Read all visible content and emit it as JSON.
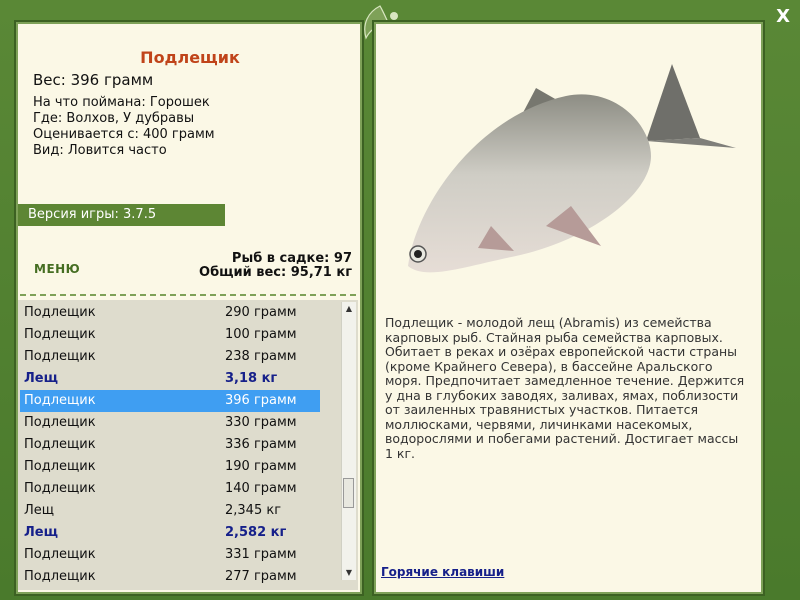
{
  "fish": {
    "name": "Подлещик",
    "weight": "Вес: 396 грамм",
    "bait": "На что поймана: Горошек",
    "place": "Где: Волхов, У дубравы",
    "rated": "Оценивается с: 400 грамм",
    "kind": "Вид: Ловится часто"
  },
  "version": "Версия игры: 3.7.5",
  "menu_label": "МЕНЮ",
  "cage": {
    "count": "Рыб в садке: 97",
    "total": "Общий вес: 95,71 кг"
  },
  "catch_list": [
    {
      "name": "Подлещик",
      "weight": "290 грамм",
      "style": "normal"
    },
    {
      "name": "Подлещик",
      "weight": "100 грамм",
      "style": "normal"
    },
    {
      "name": "Подлещик",
      "weight": "238 грамм",
      "style": "normal"
    },
    {
      "name": "Лещ",
      "weight": "3,18 кг",
      "style": "bold"
    },
    {
      "name": "Подлещик",
      "weight": "396 грамм",
      "style": "selected"
    },
    {
      "name": "Подлещик",
      "weight": "330 грамм",
      "style": "normal"
    },
    {
      "name": "Подлещик",
      "weight": "336 грамм",
      "style": "normal"
    },
    {
      "name": "Подлещик",
      "weight": "190 грамм",
      "style": "normal"
    },
    {
      "name": "Подлещик",
      "weight": "140 грамм",
      "style": "normal"
    },
    {
      "name": "Лещ",
      "weight": "2,345 кг",
      "style": "normal"
    },
    {
      "name": "Лещ",
      "weight": "2,582 кг",
      "style": "bold"
    },
    {
      "name": "Подлещик",
      "weight": "331 грамм",
      "style": "normal"
    },
    {
      "name": "Подлещик",
      "weight": "277 грамм",
      "style": "normal"
    }
  ],
  "description": "Подлещик - молодой лещ (Abramis) из семейства карповых рыб. Стайная рыба семейства карповых. Обитает в реках и озёрах европейской части страны (кроме Крайнего Севера), в бассейне Аральского моря. Предпочитает замедленное течение. Держится у дна в глубоких заводях, заливах, ямах, поблизости от заиленных травянистых участков. Питается моллюсками, червями, личинками насекомых, водорослями и побегами растений. Достигает массы 1 кг.",
  "hotkeys": "Горячие клавиши",
  "close_symbol": "X",
  "colors": {
    "frame": "#4e7a30",
    "panel": "#fbf8e6",
    "title": "#c0441a",
    "highlight": "#3f9ef2",
    "bold_row": "#16208a"
  }
}
